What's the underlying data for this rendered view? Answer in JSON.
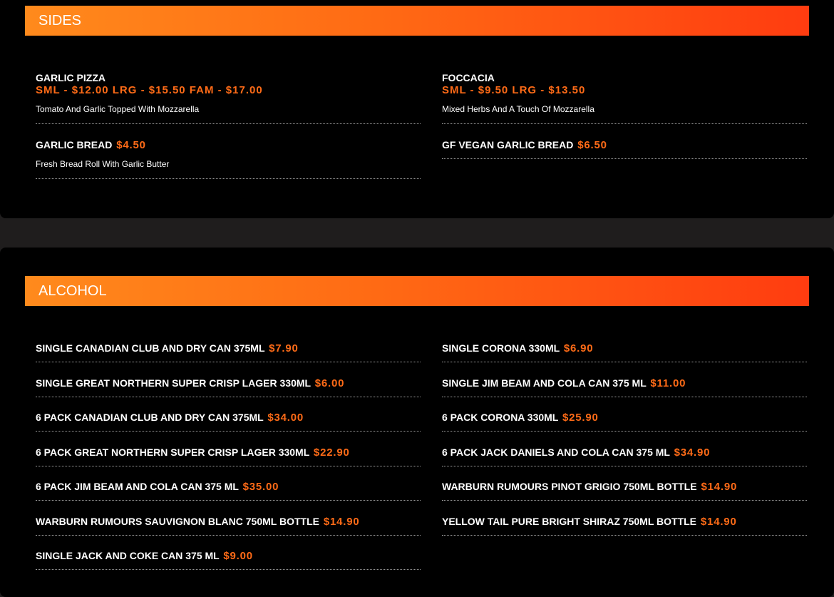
{
  "sides": {
    "heading": "SIDES",
    "items": [
      {
        "name": "GARLIC PIZZA",
        "prices": "SML - $12.00 LRG - $15.50 FAM - $17.00",
        "description": "Tomato And Garlic Topped With Mozzarella"
      },
      {
        "name": "FOCCACIA",
        "prices": "SML - $9.50 LRG - $13.50",
        "description": "Mixed Herbs And A Touch Of Mozzarella"
      },
      {
        "name": "GARLIC BREAD",
        "price": "$4.50",
        "description": "Fresh Bread Roll With Garlic Butter"
      },
      {
        "name": "GF VEGAN GARLIC BREAD",
        "price": "$6.50"
      }
    ]
  },
  "alcohol": {
    "heading": "ALCOHOL",
    "items": [
      {
        "name": "SINGLE CANADIAN CLUB AND DRY CAN 375ML",
        "price": "$7.90"
      },
      {
        "name": "SINGLE CORONA 330ML",
        "price": "$6.90"
      },
      {
        "name": "SINGLE GREAT NORTHERN SUPER CRISP LAGER 330ML",
        "price": "$6.00"
      },
      {
        "name": "SINGLE JIM BEAM AND COLA CAN 375 ML",
        "price": "$11.00"
      },
      {
        "name": "6 PACK CANADIAN CLUB AND DRY CAN 375ML",
        "price": "$34.00"
      },
      {
        "name": "6 PACK CORONA 330ML",
        "price": "$25.90"
      },
      {
        "name": "6 PACK GREAT NORTHERN SUPER CRISP LAGER 330ML",
        "price": "$22.90"
      },
      {
        "name": "6 PACK JACK DANIELS AND COLA CAN 375 ML",
        "price": "$34.90"
      },
      {
        "name": "6 PACK JIM BEAM AND COLA CAN 375 ML",
        "price": "$35.00"
      },
      {
        "name": "WARBURN RUMOURS PINOT GRIGIO 750ML BOTTLE",
        "price": "$14.90"
      },
      {
        "name": "WARBURN RUMOURS SAUVIGNON BLANC 750ML BOTTLE",
        "price": "$14.90"
      },
      {
        "name": "YELLOW TAIL PURE BRIGHT SHIRAZ 750ML BOTTLE",
        "price": "$14.90"
      },
      {
        "name": "SINGLE JACK AND COKE CAN 375 ML",
        "price": "$9.00"
      }
    ]
  },
  "colors": {
    "accent": "#ff6b17",
    "banner_start": "#ff8a1c",
    "banner_end": "#ff3c10",
    "panel": "#000000",
    "page": "#1f1d1d"
  }
}
